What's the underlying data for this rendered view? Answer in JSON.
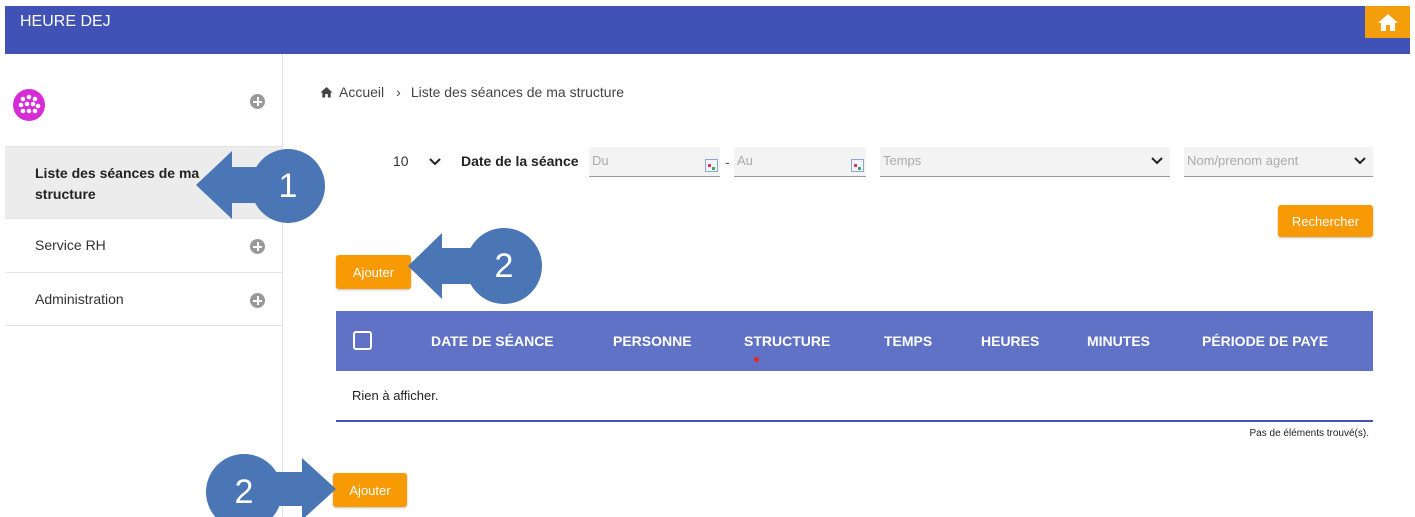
{
  "app": {
    "title": "HEURE DEJ"
  },
  "icons": {
    "home": "home-icon",
    "breadcrumb_home": "home-icon",
    "plus": "plus-circle-icon",
    "calendar": "calendar-icon",
    "chevron": "chevron-down-icon",
    "logo": "logo-icon"
  },
  "colors": {
    "header": "#4152b6",
    "table_header": "#6072c6",
    "accent": "#f79a04",
    "annotation": "#4a76b5"
  },
  "sidebar": {
    "items": [
      {
        "label": "Liste des séances de ma structure",
        "line1": "Liste des séances de ma",
        "line2": "structure",
        "active": true
      },
      {
        "label": "Service RH",
        "active": false
      },
      {
        "label": "Administration",
        "active": false
      }
    ]
  },
  "breadcrumb": {
    "home": "Accueil",
    "separator": "›",
    "current": "Liste des séances de ma structure"
  },
  "filters": {
    "page_size": "10",
    "date_label": "Date de la séance",
    "date_from_placeholder": "Du",
    "date_separator": "-",
    "date_to_placeholder": "Au",
    "temps_placeholder": "Temps",
    "agent_placeholder": "Nom/prenom agent",
    "search_button": "Rechercher"
  },
  "actions": {
    "add_top": "Ajouter",
    "add_bottom": "Ajouter"
  },
  "table": {
    "columns": [
      "DATE DE SÉANCE",
      "PERSONNE",
      "STRUCTURE",
      "TEMPS",
      "HEURES",
      "MINUTES",
      "PÉRIODE DE PAYE"
    ],
    "empty_message": "Rien à afficher.",
    "footer": "Pas de éléments trouvé(s)."
  },
  "annotations": {
    "c1": "1",
    "c2a": "2",
    "c2b": "2"
  }
}
